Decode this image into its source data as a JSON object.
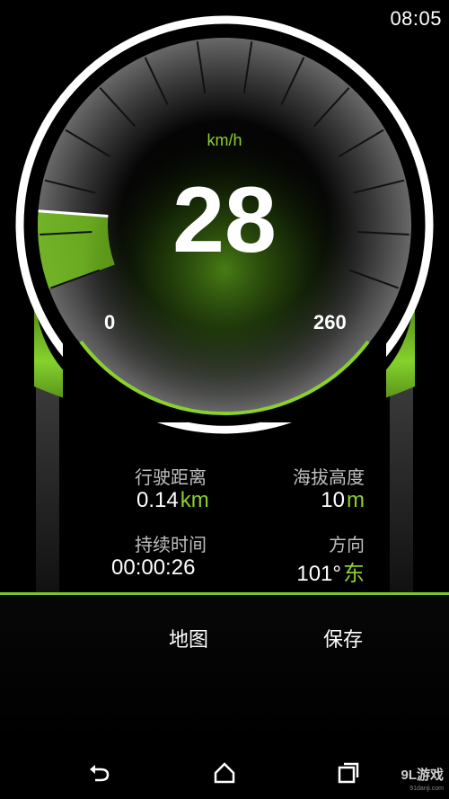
{
  "status": {
    "time": "08:05"
  },
  "gauge": {
    "unit": "km/h",
    "speed": "28",
    "min_label": "0",
    "max_label": "260",
    "fill_fraction": 0.11,
    "accent_color": "#7cc62a"
  },
  "stats": {
    "distance": {
      "label": "行驶距离",
      "value": "0.14",
      "unit": "km"
    },
    "altitude": {
      "label": "海拔高度",
      "value": "10",
      "unit": "m"
    },
    "duration": {
      "label": "持续时间",
      "value": "00:00:26"
    },
    "direction": {
      "label": "方向",
      "value": "101°",
      "unit": "东"
    }
  },
  "actions": {
    "map": "地图",
    "save": "保存"
  },
  "nav": {
    "back_icon": "back-icon",
    "home_icon": "home-icon",
    "recents_icon": "recents-icon"
  },
  "watermark": {
    "brand": "9L游戏",
    "site": "91danji.com"
  }
}
